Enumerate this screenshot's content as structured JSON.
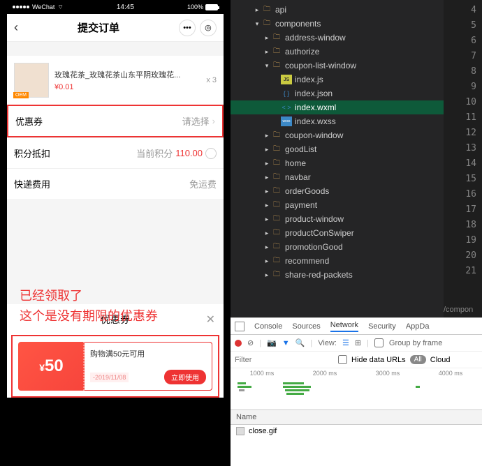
{
  "phone": {
    "status": {
      "carrier": "WeChat",
      "time": "14:45",
      "battery": "100%"
    },
    "nav": {
      "title": "提交订单",
      "back": "‹",
      "more": "•••",
      "target": "◎"
    },
    "product": {
      "name": "玫瑰花茶_玫瑰花茶山东平阴玫瑰花...",
      "price": "¥0.01",
      "qty": "x 3",
      "badge": "OEM"
    },
    "rows": {
      "coupon": {
        "label": "优惠券",
        "value": "请选择",
        "arrow": "›"
      },
      "points": {
        "label": "积分抵扣",
        "prefix": "当前积分",
        "value": "110.00"
      },
      "shipping": {
        "label": "快递费用",
        "value": "免运费"
      }
    },
    "modal": {
      "title": "优惠券",
      "close": "✕",
      "coupon": {
        "amount": "50",
        "yen": "¥",
        "desc": "购物满50元可用",
        "date": "-2019/11/08",
        "btn": "立即使用"
      }
    },
    "annotation": {
      "line1": "已经领取了",
      "line2": "这个是没有期限的优惠券"
    }
  },
  "tree": {
    "items": [
      {
        "depth": 2,
        "arrow": "▸",
        "icon": "folder",
        "label": "api"
      },
      {
        "depth": 2,
        "arrow": "▾",
        "icon": "folder",
        "label": "components"
      },
      {
        "depth": 3,
        "arrow": "▸",
        "icon": "folder",
        "label": "address-window"
      },
      {
        "depth": 3,
        "arrow": "▸",
        "icon": "folder",
        "label": "authorize"
      },
      {
        "depth": 3,
        "arrow": "▾",
        "icon": "folder",
        "label": "coupon-list-window"
      },
      {
        "depth": 4,
        "arrow": "",
        "icon": "js",
        "label": "index.js"
      },
      {
        "depth": 4,
        "arrow": "",
        "icon": "json",
        "label": "index.json"
      },
      {
        "depth": 4,
        "arrow": "",
        "icon": "wxml",
        "label": "index.wxml",
        "selected": true
      },
      {
        "depth": 4,
        "arrow": "",
        "icon": "wxss",
        "label": "index.wxss"
      },
      {
        "depth": 3,
        "arrow": "▸",
        "icon": "folder",
        "label": "coupon-window"
      },
      {
        "depth": 3,
        "arrow": "▸",
        "icon": "folder",
        "label": "goodList"
      },
      {
        "depth": 3,
        "arrow": "▸",
        "icon": "folder",
        "label": "home"
      },
      {
        "depth": 3,
        "arrow": "▸",
        "icon": "folder",
        "label": "navbar"
      },
      {
        "depth": 3,
        "arrow": "▸",
        "icon": "folder",
        "label": "orderGoods"
      },
      {
        "depth": 3,
        "arrow": "▸",
        "icon": "folder",
        "label": "payment"
      },
      {
        "depth": 3,
        "arrow": "▸",
        "icon": "folder",
        "label": "product-window"
      },
      {
        "depth": 3,
        "arrow": "▸",
        "icon": "folder",
        "label": "productConSwiper"
      },
      {
        "depth": 3,
        "arrow": "▸",
        "icon": "folder",
        "label": "promotionGood"
      },
      {
        "depth": 3,
        "arrow": "▸",
        "icon": "folder",
        "label": "recommend"
      },
      {
        "depth": 3,
        "arrow": "▸",
        "icon": "folder",
        "label": "share-red-packets"
      }
    ]
  },
  "linenums": [
    "4",
    "5",
    "6",
    "7",
    "8",
    "9",
    "10",
    "11",
    "12",
    "13",
    "14",
    "15",
    "16",
    "17",
    "18",
    "19",
    "20",
    "21"
  ],
  "breadcrumb": "/compon",
  "devtools": {
    "tabs": [
      "Console",
      "Sources",
      "Network",
      "Security",
      "AppDa"
    ],
    "activeTab": "Network",
    "view": "View:",
    "groupByFrame": "Group by frame",
    "filter": "Filter",
    "hideData": "Hide data URLs",
    "all": "All",
    "cloud": "Cloud",
    "timeline": [
      "1000 ms",
      "2000 ms",
      "3000 ms",
      "4000 ms"
    ],
    "nameHeader": "Name",
    "file": "close.gif"
  }
}
